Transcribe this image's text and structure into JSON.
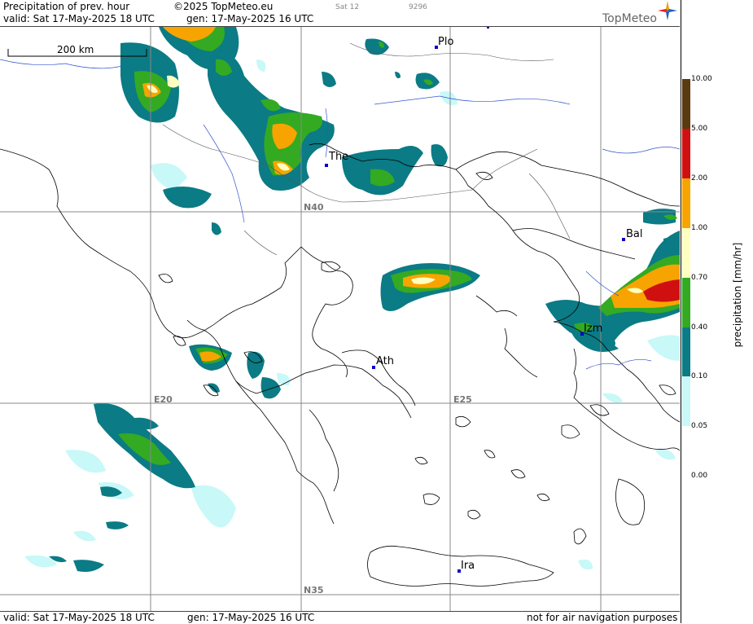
{
  "header": {
    "product": "Precipitation of prev. hour",
    "copyright": "©2025 TopMeteo.eu",
    "sat": "Sat 12",
    "run_code": "9296",
    "valid": "valid:  Sat  17-May-2025  18 UTC",
    "gen": "gen: 17-May-2025 16 UTC",
    "logo": "TopMeteo"
  },
  "footer": {
    "valid": "valid:  Sat  17-May-2025  18 UTC",
    "gen": "gen: 17-May-2025 16 UTC",
    "note": "not for air navigation purposes"
  },
  "map": {
    "scale_label": "200 km",
    "cities": [
      {
        "id": "plo",
        "label": "Plo"
      },
      {
        "id": "the",
        "label": "The"
      },
      {
        "id": "bal",
        "label": "Bal"
      },
      {
        "id": "izm",
        "label": "Izm"
      },
      {
        "id": "ath",
        "label": "Ath"
      },
      {
        "id": "ira",
        "label": "Ira"
      }
    ],
    "grid_labels": {
      "n40": "N40",
      "n35": "N35",
      "e20": "E20",
      "e25": "E25"
    }
  },
  "legend": {
    "unit": "precipitation [mm/hr]",
    "ticks": [
      "10.00",
      "5.00",
      "2.00",
      "1.00",
      "0.70",
      "0.40",
      "0.10",
      "0.05",
      "0.00"
    ],
    "colors": {
      "c1000": "#5a3a10",
      "c500": "#d01010",
      "c200": "#f7a400",
      "c100": "#ffffc0",
      "c070": "#33aa22",
      "c040": "#0b7b85",
      "c010": "#c8f8f8"
    }
  }
}
